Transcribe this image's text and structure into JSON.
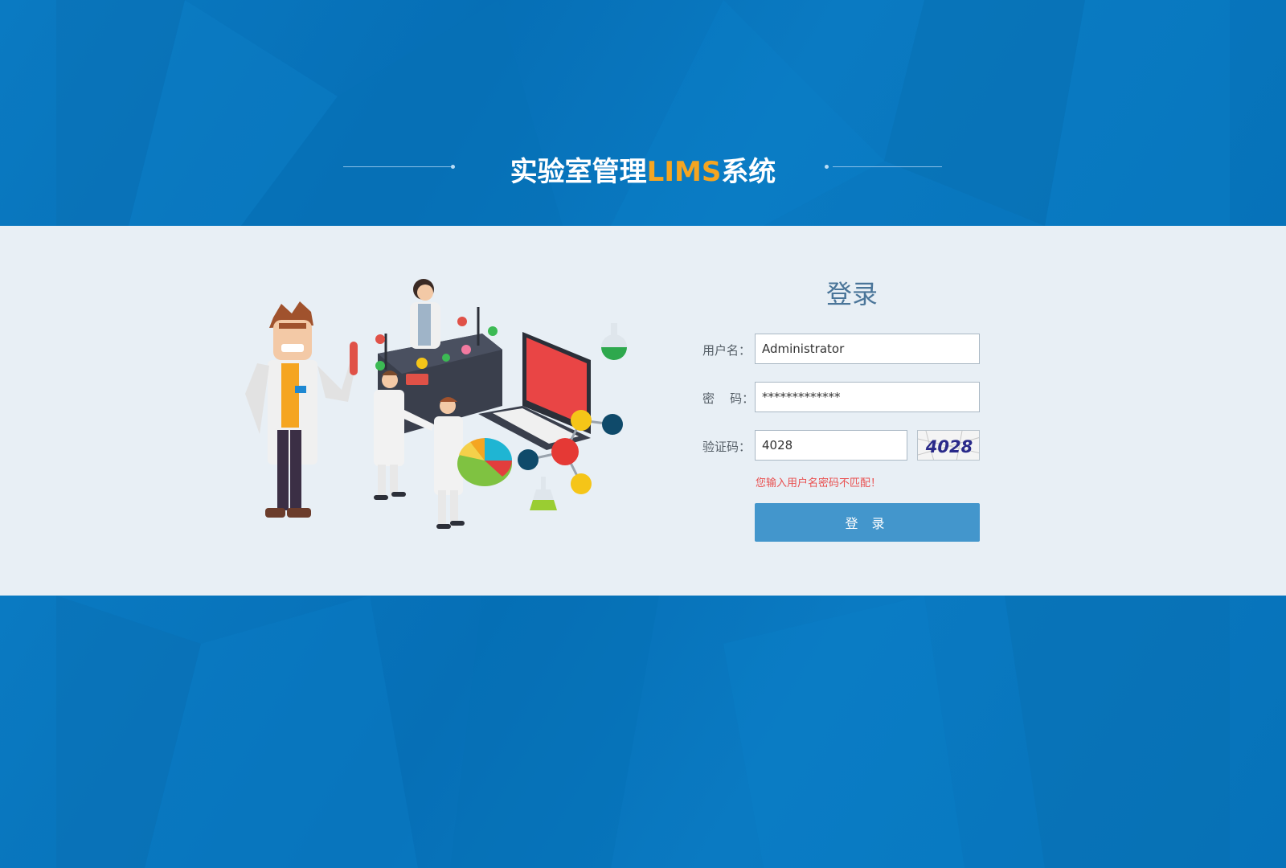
{
  "header": {
    "title_prefix": "实验室管理",
    "title_accent": "LIMS",
    "title_suffix": "系统"
  },
  "login": {
    "heading": "登录",
    "username_label": "用户名：",
    "username_value": "Administrator",
    "password_label": "密    码：",
    "password_value": "*************",
    "captcha_label": "验证码：",
    "captcha_value": "4028",
    "captcha_image_text": "4028",
    "error_message": "您输入用户名密码不匹配！",
    "submit_label": "登 录"
  },
  "colors": {
    "background_blue": "#0775bd",
    "band": "#e8eff5",
    "title_accent": "#f5a521",
    "button": "#4396cc",
    "error": "#e94f4f"
  }
}
